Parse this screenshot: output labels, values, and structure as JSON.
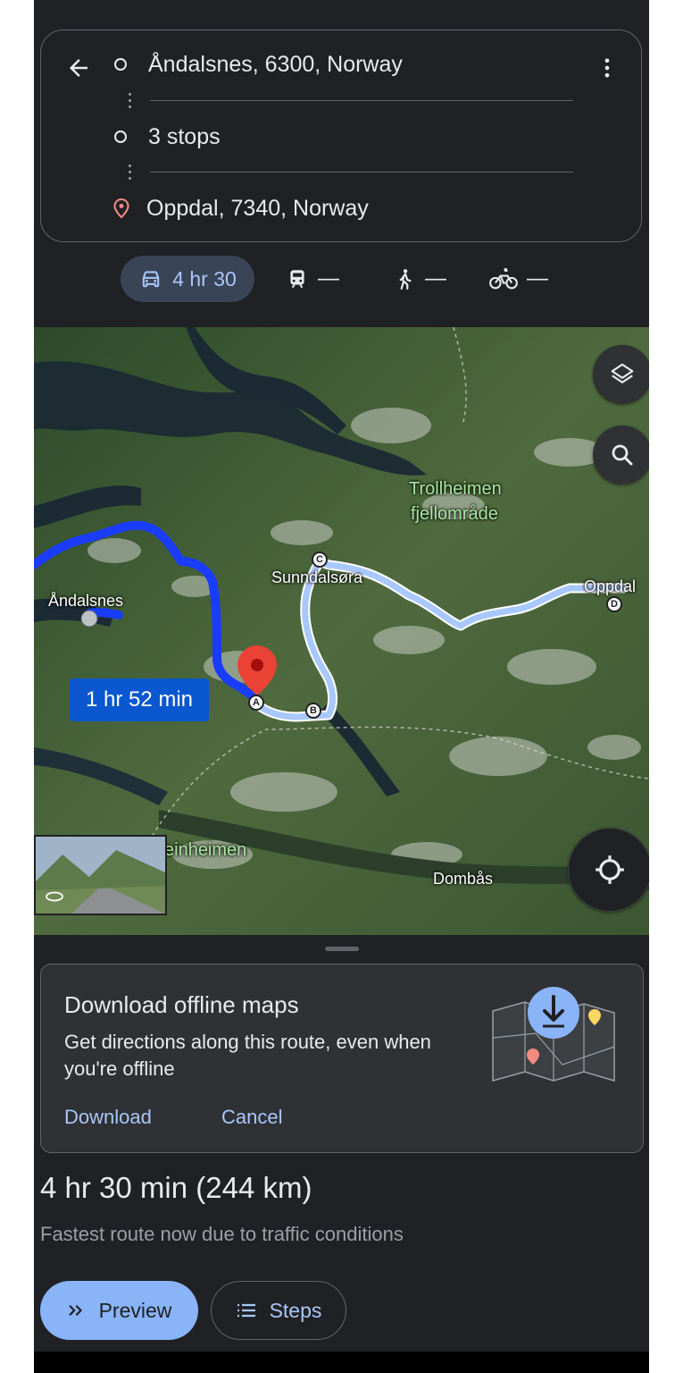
{
  "route": {
    "origin": "Åndalsnes, 6300, Norway",
    "stops": "3 stops",
    "destination": "Oppdal, 7340, Norway"
  },
  "modes": {
    "drive": "4 hr 30",
    "transit": "—",
    "walk": "—",
    "bike": "—"
  },
  "map": {
    "duration_label": "1 hr 52 min",
    "places": {
      "andalsnes": "Åndalsnes",
      "sunndalsora": "Sunndalsøra",
      "oppdal": "Oppdal",
      "trollheimen1": "Trollheimen",
      "trollheimen2": "fjellområde",
      "reinheimen": "einheimen",
      "dombas": "Dombås"
    },
    "waypoints": {
      "a": "A",
      "b": "B",
      "c": "C",
      "d": "D"
    }
  },
  "offline": {
    "title": "Download offline maps",
    "description": "Get directions along this route, even when you're offline",
    "download": "Download",
    "cancel": "Cancel"
  },
  "summary": {
    "total": "4 hr 30 min (244 km)",
    "note": "Fastest route now due to traffic conditions"
  },
  "actions": {
    "preview": "Preview",
    "steps": "Steps"
  },
  "colors": {
    "background": "#202124",
    "accent": "#8ab4f8",
    "route_primary": "#1a3cff",
    "route_alt": "#a8c8ff"
  }
}
